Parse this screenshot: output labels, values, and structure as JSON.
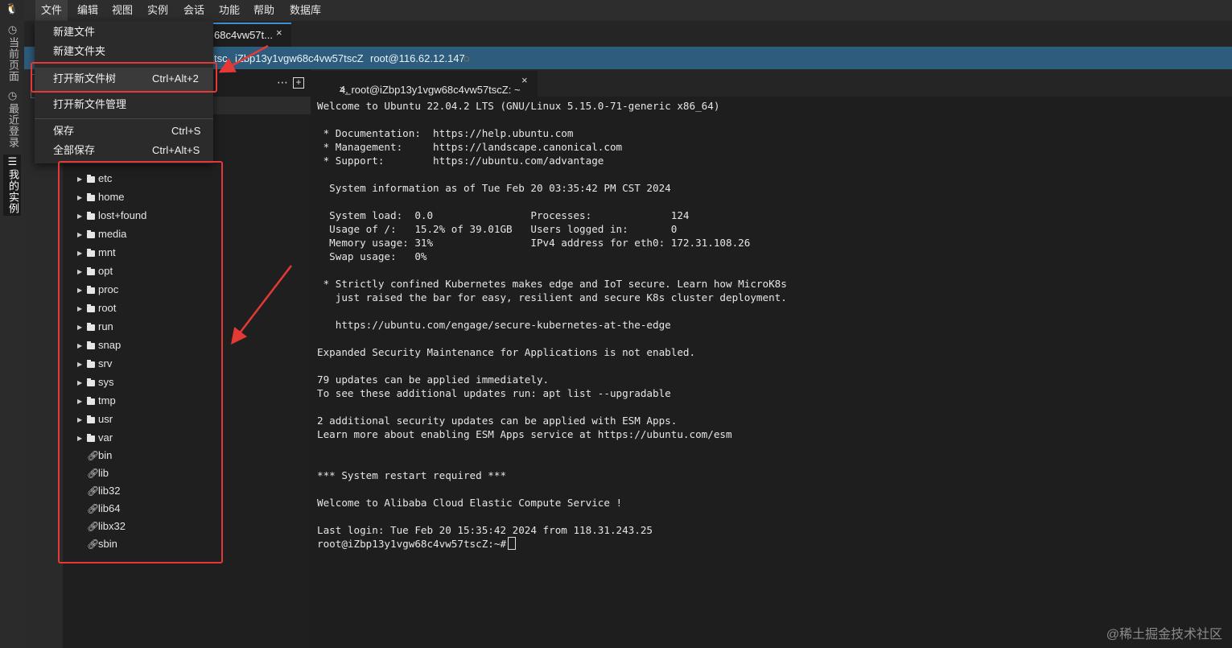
{
  "menubar": {
    "items": [
      "文件",
      "编辑",
      "视图",
      "实例",
      "会话",
      "功能",
      "帮助",
      "数据库"
    ]
  },
  "rail": {
    "tabs": [
      "当前页面",
      "最近登录",
      "我的实例"
    ],
    "icons": [
      "clock-icon",
      "history-icon",
      "list-icon"
    ]
  },
  "session_tab": {
    "label": "68c4vw57t...",
    "close": "×"
  },
  "infobar": {
    "host_short": "tsc",
    "host": "iZbp13y1vgw68c4vw57tscZ",
    "user_at": "root@116.62.12.147"
  },
  "file_menu": {
    "items": [
      {
        "label": "新建文件",
        "shortcut": ""
      },
      {
        "label": "新建文件夹",
        "shortcut": ""
      },
      {
        "label": "打开新文件树",
        "shortcut": "Ctrl+Alt+2"
      },
      {
        "label": "打开新文件管理",
        "shortcut": ""
      },
      {
        "label": "保存",
        "shortcut": "Ctrl+S"
      },
      {
        "label": "全部保存",
        "shortcut": "Ctrl+Alt+S"
      }
    ]
  },
  "tree": {
    "folders": [
      "etc",
      "home",
      "lost+found",
      "media",
      "mnt",
      "opt",
      "proc",
      "root",
      "run",
      "snap",
      "srv",
      "sys",
      "tmp",
      "usr",
      "var"
    ],
    "links": [
      "bin",
      "lib",
      "lib32",
      "lib64",
      "libx32",
      "sbin"
    ]
  },
  "terminal_tab": {
    "label": "4. root@iZbp13y1vgw68c4vw57tscZ: ~",
    "prompt_icon": ">_",
    "close": "×"
  },
  "terminal": {
    "lines": "Welcome to Ubuntu 22.04.2 LTS (GNU/Linux 5.15.0-71-generic x86_64)\n\n * Documentation:  https://help.ubuntu.com\n * Management:     https://landscape.canonical.com\n * Support:        https://ubuntu.com/advantage\n\n  System information as of Tue Feb 20 03:35:42 PM CST 2024\n\n  System load:  0.0                Processes:             124\n  Usage of /:   15.2% of 39.01GB   Users logged in:       0\n  Memory usage: 31%                IPv4 address for eth0: 172.31.108.26\n  Swap usage:   0%\n\n * Strictly confined Kubernetes makes edge and IoT secure. Learn how MicroK8s\n   just raised the bar for easy, resilient and secure K8s cluster deployment.\n\n   https://ubuntu.com/engage/secure-kubernetes-at-the-edge\n\nExpanded Security Maintenance for Applications is not enabled.\n\n79 updates can be applied immediately.\nTo see these additional updates run: apt list --upgradable\n\n2 additional security updates can be applied with ESM Apps.\nLearn more about enabling ESM Apps service at https://ubuntu.com/esm\n\n\n*** System restart required ***\n\nWelcome to Alibaba Cloud Elastic Compute Service !\n\nLast login: Tue Feb 20 15:35:42 2024 from 118.31.243.25\nroot@iZbp13y1vgw68c4vw57tscZ:~#"
  },
  "watermark": "@稀土掘金技术社区",
  "colors": {
    "accent": "#3c8fd4",
    "annotation": "#e53935",
    "infobar": "#2d5c7c"
  }
}
